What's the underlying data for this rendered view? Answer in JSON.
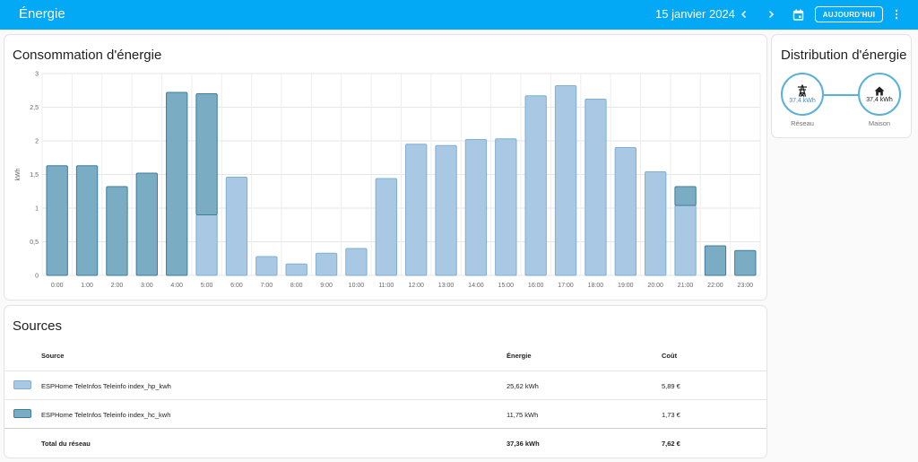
{
  "header": {
    "title": "Énergie",
    "date": "15 janvier 2024",
    "today_label": "AUJOURD'HUI"
  },
  "consumption": {
    "title": "Consommation d'énergie"
  },
  "chart_data": {
    "type": "bar",
    "stacked": true,
    "ylabel": "kWh",
    "ylim": [
      0,
      3
    ],
    "yticks": [
      "0",
      "0,5",
      "1",
      "1,5",
      "2",
      "2,5",
      "3"
    ],
    "categories": [
      "0:00",
      "1:00",
      "2:00",
      "3:00",
      "4:00",
      "5:00",
      "6:00",
      "7:00",
      "8:00",
      "9:00",
      "10:00",
      "11:00",
      "12:00",
      "13:00",
      "14:00",
      "15:00",
      "16:00",
      "17:00",
      "18:00",
      "19:00",
      "20:00",
      "21:00",
      "22:00",
      "23:00"
    ],
    "series": [
      {
        "name": "ESPHome TeleInfos Teleinfo index_hp_kwh",
        "color": "#a9c8e3",
        "values": [
          0,
          0,
          0,
          0,
          0,
          0.9,
          1.46,
          0.28,
          0.17,
          0.33,
          0.4,
          1.44,
          1.95,
          1.93,
          2.02,
          2.03,
          2.67,
          2.82,
          2.62,
          1.9,
          1.54,
          1.04,
          0,
          0
        ]
      },
      {
        "name": "ESPHome TeleInfos Teleinfo index_hc_kwh",
        "color": "#7aadc4",
        "values": [
          1.63,
          1.63,
          1.32,
          1.52,
          2.72,
          1.8,
          0,
          0,
          0,
          0,
          0,
          0,
          0,
          0,
          0,
          0,
          0,
          0,
          0,
          0,
          0,
          0.28,
          0.44,
          0.37
        ]
      }
    ],
    "grid": true
  },
  "distribution": {
    "title": "Distribution d'énergie",
    "grid": {
      "value": "37,4 kWh",
      "label": "Réseau"
    },
    "home": {
      "value": "37,4 kWh",
      "label": "Maison"
    }
  },
  "sources": {
    "title": "Sources",
    "headers": {
      "source": "Source",
      "energy": "Énergie",
      "cost": "Coût"
    },
    "rows": [
      {
        "name": "ESPHome TeleInfos Teleinfo index_hp_kwh",
        "energy": "25,62 kWh",
        "cost": "5,89 €",
        "color": "#a9c8e3",
        "border": "#7fafd3"
      },
      {
        "name": "ESPHome TeleInfos Teleinfo index_hc_kwh",
        "energy": "11,75 kWh",
        "cost": "1,73 €",
        "color": "#7aadc4",
        "border": "#3d7d9c"
      }
    ],
    "total": {
      "name": "Total du réseau",
      "energy": "37,36 kWh",
      "cost": "7,62 €"
    }
  }
}
